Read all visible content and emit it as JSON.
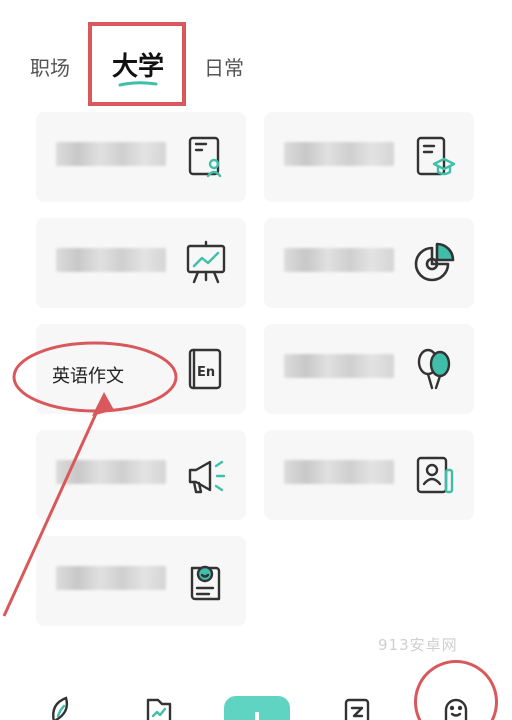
{
  "tabs": [
    {
      "label": "职场"
    },
    {
      "label": "大学"
    },
    {
      "label": "日常"
    }
  ],
  "active_tab": "大学",
  "cards": [
    {
      "icon": "resume-profile-icon",
      "label": ""
    },
    {
      "icon": "graduation-document-icon",
      "label": ""
    },
    {
      "icon": "presentation-board-icon",
      "label": ""
    },
    {
      "icon": "pie-chart-icon",
      "label": ""
    },
    {
      "icon": "english-book-icon",
      "label": ""
    },
    {
      "icon": "balloons-icon",
      "label": ""
    },
    {
      "icon": "megaphone-icon",
      "label": ""
    },
    {
      "icon": "id-card-icon",
      "label": ""
    },
    {
      "icon": "certificate-smile-icon",
      "label": ""
    }
  ],
  "annotation": {
    "text": "英语作文"
  },
  "watermark": "913安卓网",
  "colors": {
    "accent": "#5fd4c2",
    "annotation": "#d9585b",
    "icon": "#333333"
  },
  "nav": [
    {
      "icon": "leaf-icon"
    },
    {
      "icon": "chart-doc-icon"
    },
    {
      "icon": "plus-icon"
    },
    {
      "icon": "document-icon"
    },
    {
      "icon": "smile-chat-icon"
    }
  ]
}
